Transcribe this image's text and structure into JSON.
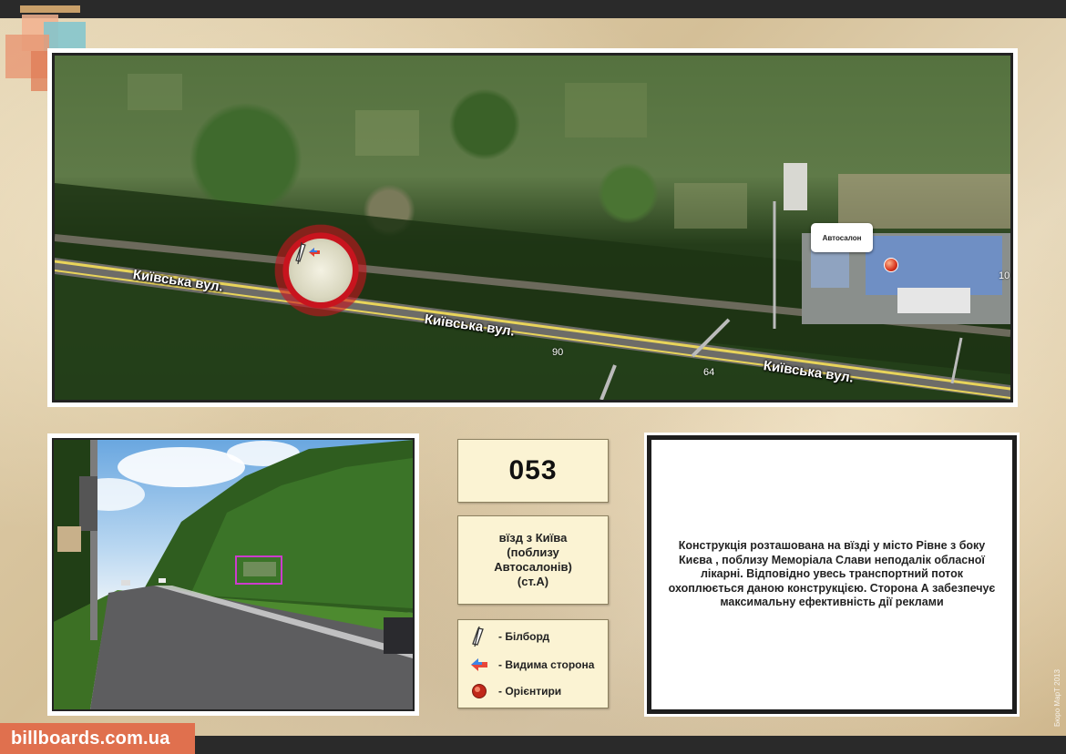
{
  "board": {
    "code": "053",
    "address_lines": [
      "вїзд з Київа",
      "(поблизу",
      "Автосалонів)",
      "(ст.А)"
    ],
    "description": "Конструкція розташована на вїзді у місто Рівне з боку Києва , поблизу Меморіала Слави неподалік обласної лікарні. Відповідно увесь транспортний поток охоплюється даною конструкцією. Сторона А забезпечує максимальну ефективність дії реклами"
  },
  "map": {
    "street_labels": [
      "Київська вул.",
      "Київська вул.",
      "Київська вул."
    ],
    "road_numbers": [
      "90",
      "64",
      "10"
    ],
    "landmark_label": "Автосалон"
  },
  "legend": {
    "items": [
      {
        "label": "- Білборд",
        "icon": "billboard-icon"
      },
      {
        "label": "- Видима сторона",
        "icon": "visible-side-arrow-icon"
      },
      {
        "label": "- Орієнтири",
        "icon": "landmark-dot-icon"
      }
    ]
  },
  "footer": {
    "site": "billboards.com.ua",
    "copyright": "Бюро МарТ 2013"
  },
  "colors": {
    "accent": "#e0704e",
    "marker_ring": "#c8141e",
    "box_fill": "#fbf3d3",
    "bar": "#2a2a2a"
  }
}
